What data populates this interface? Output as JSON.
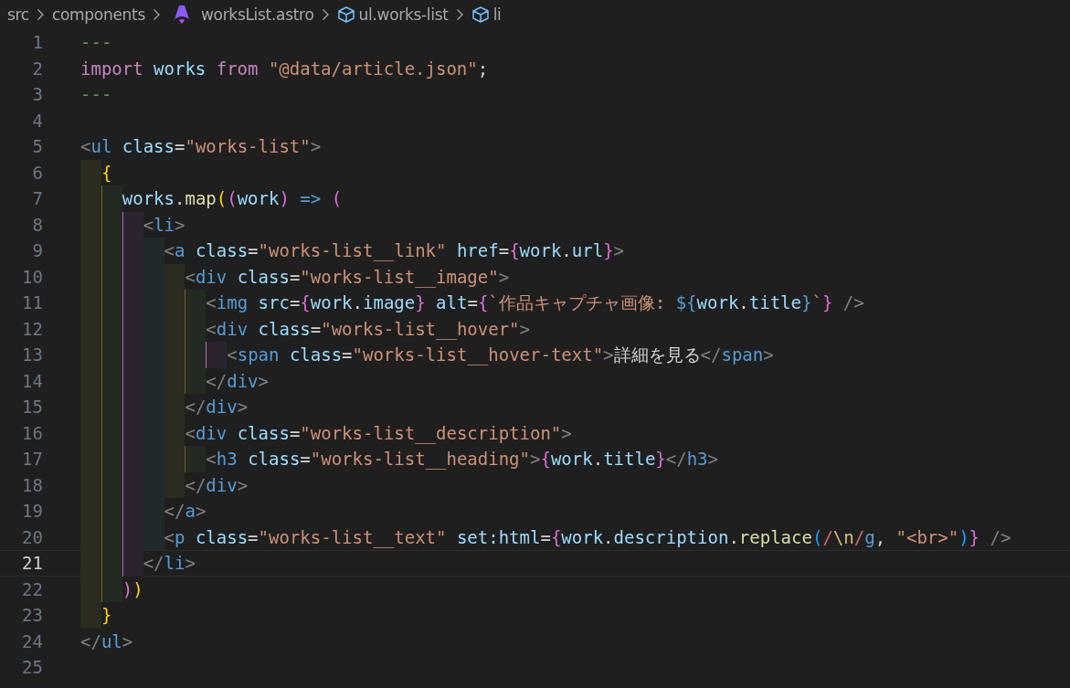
{
  "breadcrumb": [
    {
      "label": "src",
      "kind": "folder"
    },
    {
      "label": "components",
      "kind": "folder"
    },
    {
      "label": "worksList.astro",
      "kind": "file"
    },
    {
      "label": "ul.works-list",
      "kind": "element"
    },
    {
      "label": "li",
      "kind": "element"
    }
  ],
  "lines": [
    {
      "number": "1",
      "current": false,
      "tokens": [
        {
          "text": "---",
          "kind": "cm"
        }
      ]
    },
    {
      "number": "2",
      "current": false,
      "tokens": [
        {
          "text": "import ",
          "kind": "kw"
        },
        {
          "text": "works ",
          "kind": "var"
        },
        {
          "text": "from ",
          "kind": "kw"
        },
        {
          "text": "\"@data/article.json\"",
          "kind": "str"
        },
        {
          "text": ";",
          "kind": "p"
        }
      ]
    },
    {
      "number": "3",
      "current": false,
      "tokens": [
        {
          "text": "---",
          "kind": "cm"
        }
      ]
    },
    {
      "number": "4",
      "current": false
    },
    {
      "number": "5",
      "current": false,
      "tokens": [
        {
          "text": "<",
          "kind": "punct"
        },
        {
          "text": "ul ",
          "kind": "tag"
        },
        {
          "text": "class",
          "kind": "attr"
        },
        {
          "text": "=",
          "kind": "p"
        },
        {
          "text": "\"works-list\"",
          "kind": "str"
        },
        {
          "text": ">",
          "kind": "punct"
        }
      ],
      "children": [
        {
          "number": "6",
          "current": false,
          "tokens": [
            {
              "text": "{",
              "kind": "br1"
            }
          ],
          "children": [
            {
              "number": "7",
              "current": false,
              "tokens": [
                {
                  "text": "works",
                  "kind": "var"
                },
                {
                  "text": ".",
                  "kind": "p"
                },
                {
                  "text": "map",
                  "kind": "fn"
                },
                {
                  "text": "(",
                  "kind": "br1"
                },
                {
                  "text": "(",
                  "kind": "br2"
                },
                {
                  "text": "work",
                  "kind": "var"
                },
                {
                  "text": ") ",
                  "kind": "br2"
                },
                {
                  "text": "=> ",
                  "kind": "op"
                },
                {
                  "text": "(",
                  "kind": "br2"
                }
              ],
              "children": [
                {
                  "number": "8",
                  "current": false,
                  "tokens": [
                    {
                      "text": "<",
                      "kind": "punct"
                    },
                    {
                      "text": "li",
                      "kind": "tag"
                    },
                    {
                      "text": ">",
                      "kind": "punct"
                    }
                  ],
                  "children": [
                    {
                      "number": "9",
                      "current": false,
                      "tokens": [
                        {
                          "text": "<",
                          "kind": "punct"
                        },
                        {
                          "text": "a ",
                          "kind": "tag"
                        },
                        {
                          "text": "class",
                          "kind": "attr"
                        },
                        {
                          "text": "=",
                          "kind": "p"
                        },
                        {
                          "text": "\"works-list__link\" ",
                          "kind": "str"
                        },
                        {
                          "text": "href",
                          "kind": "attr"
                        },
                        {
                          "text": "=",
                          "kind": "p"
                        },
                        {
                          "text": "{",
                          "kind": "br2"
                        },
                        {
                          "text": "work",
                          "kind": "var"
                        },
                        {
                          "text": ".",
                          "kind": "p"
                        },
                        {
                          "text": "url",
                          "kind": "var"
                        },
                        {
                          "text": "}",
                          "kind": "br2"
                        },
                        {
                          "text": ">",
                          "kind": "punct"
                        }
                      ],
                      "children": [
                        {
                          "number": "10",
                          "current": false,
                          "tokens": [
                            {
                              "text": "<",
                              "kind": "punct"
                            },
                            {
                              "text": "div ",
                              "kind": "tag"
                            },
                            {
                              "text": "class",
                              "kind": "attr"
                            },
                            {
                              "text": "=",
                              "kind": "p"
                            },
                            {
                              "text": "\"works-list__image\"",
                              "kind": "str"
                            },
                            {
                              "text": ">",
                              "kind": "punct"
                            }
                          ],
                          "children": [
                            {
                              "number": "11",
                              "current": false,
                              "tokens": [
                                {
                                  "text": "<",
                                  "kind": "punct"
                                },
                                {
                                  "text": "img ",
                                  "kind": "tag"
                                },
                                {
                                  "text": "src",
                                  "kind": "attr"
                                },
                                {
                                  "text": "=",
                                  "kind": "p"
                                },
                                {
                                  "text": "{",
                                  "kind": "br2"
                                },
                                {
                                  "text": "work",
                                  "kind": "var"
                                },
                                {
                                  "text": ".",
                                  "kind": "p"
                                },
                                {
                                  "text": "image",
                                  "kind": "var"
                                },
                                {
                                  "text": "} ",
                                  "kind": "br2"
                                },
                                {
                                  "text": "alt",
                                  "kind": "attr"
                                },
                                {
                                  "text": "=",
                                  "kind": "p"
                                },
                                {
                                  "text": "{",
                                  "kind": "br2"
                                },
                                {
                                  "text": "`作品キャプチャ画像: ",
                                  "kind": "str"
                                },
                                {
                                  "text": "${",
                                  "kind": "tag"
                                },
                                {
                                  "text": "work",
                                  "kind": "var"
                                },
                                {
                                  "text": ".",
                                  "kind": "p"
                                },
                                {
                                  "text": "title",
                                  "kind": "var"
                                },
                                {
                                  "text": "}",
                                  "kind": "tag"
                                },
                                {
                                  "text": "`",
                                  "kind": "str"
                                },
                                {
                                  "text": "} ",
                                  "kind": "br2"
                                },
                                {
                                  "text": "/>",
                                  "kind": "punct"
                                }
                              ]
                            },
                            {
                              "number": "12",
                              "current": false,
                              "tokens": [
                                {
                                  "text": "<",
                                  "kind": "punct"
                                },
                                {
                                  "text": "div ",
                                  "kind": "tag"
                                },
                                {
                                  "text": "class",
                                  "kind": "attr"
                                },
                                {
                                  "text": "=",
                                  "kind": "p"
                                },
                                {
                                  "text": "\"works-list__hover\"",
                                  "kind": "str"
                                },
                                {
                                  "text": ">",
                                  "kind": "punct"
                                }
                              ],
                              "children": [
                                {
                                  "number": "13",
                                  "current": false,
                                  "tokens": [
                                    {
                                      "text": "<",
                                      "kind": "punct"
                                    },
                                    {
                                      "text": "span ",
                                      "kind": "tag"
                                    },
                                    {
                                      "text": "class",
                                      "kind": "attr"
                                    },
                                    {
                                      "text": "=",
                                      "kind": "p"
                                    },
                                    {
                                      "text": "\"works-list__hover-text\"",
                                      "kind": "str"
                                    },
                                    {
                                      "text": ">",
                                      "kind": "punct"
                                    },
                                    {
                                      "text": "詳細を見る",
                                      "kind": "p"
                                    },
                                    {
                                      "text": "</",
                                      "kind": "punct"
                                    },
                                    {
                                      "text": "span",
                                      "kind": "tag"
                                    },
                                    {
                                      "text": ">",
                                      "kind": "punct"
                                    }
                                  ]
                                }
                              ]
                            },
                            {
                              "number": "14",
                              "current": false,
                              "tokens": [
                                {
                                  "text": "</",
                                  "kind": "punct"
                                },
                                {
                                  "text": "div",
                                  "kind": "tag"
                                },
                                {
                                  "text": ">",
                                  "kind": "punct"
                                }
                              ]
                            }
                          ]
                        },
                        {
                          "number": "15",
                          "current": false,
                          "tokens": [
                            {
                              "text": "</",
                              "kind": "punct"
                            },
                            {
                              "text": "div",
                              "kind": "tag"
                            },
                            {
                              "text": ">",
                              "kind": "punct"
                            }
                          ]
                        },
                        {
                          "number": "16",
                          "current": false,
                          "tokens": [
                            {
                              "text": "<",
                              "kind": "punct"
                            },
                            {
                              "text": "div ",
                              "kind": "tag"
                            },
                            {
                              "text": "class",
                              "kind": "attr"
                            },
                            {
                              "text": "=",
                              "kind": "p"
                            },
                            {
                              "text": "\"works-list__description\"",
                              "kind": "str"
                            },
                            {
                              "text": ">",
                              "kind": "punct"
                            }
                          ],
                          "children": [
                            {
                              "number": "17",
                              "current": false,
                              "tokens": [
                                {
                                  "text": "<",
                                  "kind": "punct"
                                },
                                {
                                  "text": "h3 ",
                                  "kind": "tag"
                                },
                                {
                                  "text": "class",
                                  "kind": "attr"
                                },
                                {
                                  "text": "=",
                                  "kind": "p"
                                },
                                {
                                  "text": "\"works-list__heading\"",
                                  "kind": "str"
                                },
                                {
                                  "text": ">",
                                  "kind": "punct"
                                },
                                {
                                  "text": "{",
                                  "kind": "br2"
                                },
                                {
                                  "text": "work",
                                  "kind": "var"
                                },
                                {
                                  "text": ".",
                                  "kind": "p"
                                },
                                {
                                  "text": "title",
                                  "kind": "var"
                                },
                                {
                                  "text": "}",
                                  "kind": "br2"
                                },
                                {
                                  "text": "</",
                                  "kind": "punct"
                                },
                                {
                                  "text": "h3",
                                  "kind": "tag"
                                },
                                {
                                  "text": ">",
                                  "kind": "punct"
                                }
                              ]
                            }
                          ]
                        },
                        {
                          "number": "18",
                          "current": false,
                          "tokens": [
                            {
                              "text": "</",
                              "kind": "punct"
                            },
                            {
                              "text": "div",
                              "kind": "tag"
                            },
                            {
                              "text": ">",
                              "kind": "punct"
                            }
                          ]
                        }
                      ]
                    },
                    {
                      "number": "19",
                      "current": false,
                      "tokens": [
                        {
                          "text": "</",
                          "kind": "punct"
                        },
                        {
                          "text": "a",
                          "kind": "tag"
                        },
                        {
                          "text": ">",
                          "kind": "punct"
                        }
                      ]
                    },
                    {
                      "number": "20",
                      "current": false,
                      "tokens": [
                        {
                          "text": "<",
                          "kind": "punct"
                        },
                        {
                          "text": "p ",
                          "kind": "tag"
                        },
                        {
                          "text": "class",
                          "kind": "attr"
                        },
                        {
                          "text": "=",
                          "kind": "p"
                        },
                        {
                          "text": "\"works-list__text\" ",
                          "kind": "str"
                        },
                        {
                          "text": "set:html",
                          "kind": "attr"
                        },
                        {
                          "text": "=",
                          "kind": "p"
                        },
                        {
                          "text": "{",
                          "kind": "br2"
                        },
                        {
                          "text": "work",
                          "kind": "var"
                        },
                        {
                          "text": ".",
                          "kind": "p"
                        },
                        {
                          "text": "description",
                          "kind": "var"
                        },
                        {
                          "text": ".",
                          "kind": "p"
                        },
                        {
                          "text": "replace",
                          "kind": "fn"
                        },
                        {
                          "text": "(",
                          "kind": "br3"
                        },
                        {
                          "text": "/",
                          "kind": "rx"
                        },
                        {
                          "text": "\\n",
                          "kind": "esc"
                        },
                        {
                          "text": "/",
                          "kind": "rx"
                        },
                        {
                          "text": "g",
                          "kind": "tag"
                        },
                        {
                          "text": ", ",
                          "kind": "p"
                        },
                        {
                          "text": "\"<br>\"",
                          "kind": "str"
                        },
                        {
                          "text": ")",
                          "kind": "br3"
                        },
                        {
                          "text": "} ",
                          "kind": "br2"
                        },
                        {
                          "text": "/>",
                          "kind": "punct"
                        }
                      ]
                    }
                  ]
                },
                {
                  "number": "21",
                  "current": true,
                  "tokens": [
                    {
                      "text": "</",
                      "kind": "punct"
                    },
                    {
                      "text": "li",
                      "kind": "tag"
                    },
                    {
                      "text": ">",
                      "kind": "punct"
                    }
                  ]
                }
              ]
            },
            {
              "number": "22",
              "current": false,
              "tokens": [
                {
                  "text": ")",
                  "kind": "br2"
                },
                {
                  "text": ")",
                  "kind": "br1"
                }
              ]
            }
          ]
        },
        {
          "number": "23",
          "current": false,
          "tokens": [
            {
              "text": "}",
              "kind": "br1"
            }
          ]
        }
      ]
    },
    {
      "number": "24",
      "current": false,
      "tokens": [
        {
          "text": "</",
          "kind": "punct"
        },
        {
          "text": "ul",
          "kind": "tag"
        },
        {
          "text": ">",
          "kind": "punct"
        }
      ]
    },
    {
      "number": "25",
      "current": false
    }
  ]
}
